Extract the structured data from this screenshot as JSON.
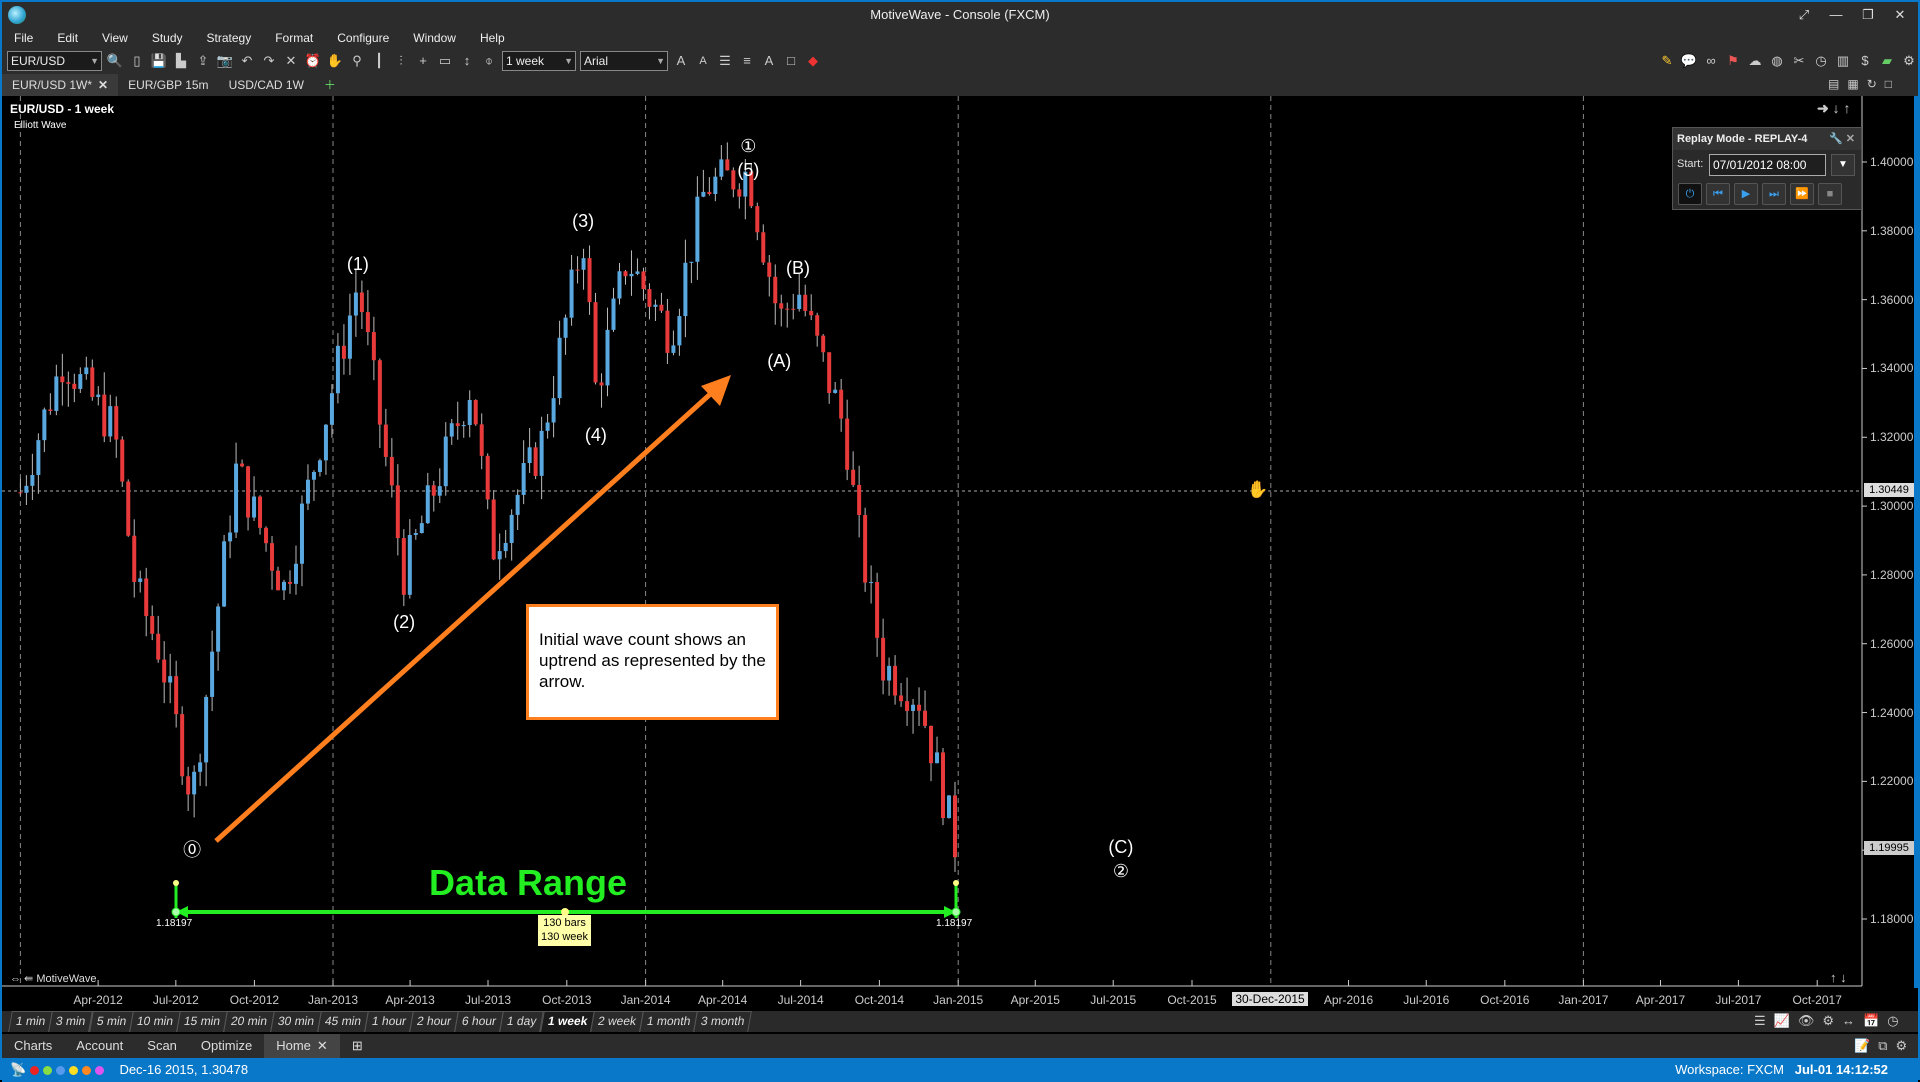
{
  "window": {
    "title": "MotiveWave - Console (FXCM)"
  },
  "menu": [
    "File",
    "Edit",
    "View",
    "Study",
    "Strategy",
    "Format",
    "Configure",
    "Window",
    "Help"
  ],
  "toolbar": {
    "symbol": "EUR/USD",
    "period": "1 week",
    "font": "Arial",
    "icons": [
      "search-icon",
      "new-icon",
      "save-icon",
      "save-as-icon",
      "export-icon",
      "camera-icon",
      "undo-icon",
      "redo-icon",
      "tools-icon",
      "alarm-icon",
      "hand-icon",
      "zoom-icon",
      "candle-icon",
      "bar-type-icon",
      "crosshair-icon",
      "measure-icon",
      "fit-icon",
      "link-icon"
    ]
  },
  "tabs": [
    {
      "label": "EUR/USD 1W*",
      "active": true
    },
    {
      "label": "EUR/GBP 15m"
    },
    {
      "label": "USD/CAD 1W"
    }
  ],
  "chart": {
    "title": "EUR/USD - 1 week",
    "study": "Elliott Wave",
    "watermark": "MotiveWave",
    "crosshair_price": "1.30449",
    "crosshair_date": "30-Dec-2015",
    "last_price": "1.19995",
    "annotation": "Initial wave count shows an uptrend as represented by the arrow.",
    "data_range": {
      "label": "Data Range",
      "start_price": "1.18197",
      "end_price": "1.18197",
      "bars": "130 bars",
      "span": "130 week"
    },
    "wave_labels": [
      {
        "text": "①",
        "date": "2014-05-01",
        "price": 1.4045
      },
      {
        "text": "(5)",
        "date": "2014-05-01",
        "price": 1.3975
      },
      {
        "text": "(3)",
        "date": "2013-10-20",
        "price": 1.3825
      },
      {
        "text": "(1)",
        "date": "2013-01-30",
        "price": 1.37
      },
      {
        "text": "(4)",
        "date": "2013-11-04",
        "price": 1.3205
      },
      {
        "text": "(2)",
        "date": "2013-03-25",
        "price": 1.266
      },
      {
        "text": "(B)",
        "date": "2014-06-28",
        "price": 1.369
      },
      {
        "text": "(A)",
        "date": "2014-06-06",
        "price": 1.342
      },
      {
        "text": "⓪",
        "date": "2012-07-20",
        "price": 1.201
      },
      {
        "text": "(C)",
        "date": "2015-07-10",
        "price": 1.2005
      },
      {
        "text": "②",
        "date": "2015-07-10",
        "price": 1.1938
      }
    ]
  },
  "chart_data": {
    "type": "candlestick",
    "symbol": "EUR/USD",
    "interval": "1 week",
    "ylim": [
      1.17,
      1.41
    ],
    "y_ticks": [
      "1.40000",
      "1.38000",
      "1.36000",
      "1.34000",
      "1.32000",
      "1.30000",
      "1.28000",
      "1.26000",
      "1.24000",
      "1.22000",
      "1.20000",
      "1.18000"
    ],
    "x_ticks": [
      {
        "label": "Apr-2012",
        "date": "2012-04-01"
      },
      {
        "label": "Jul-2012",
        "date": "2012-07-01"
      },
      {
        "label": "Oct-2012",
        "date": "2012-10-01"
      },
      {
        "label": "Jan-2013",
        "date": "2013-01-01"
      },
      {
        "label": "Apr-2013",
        "date": "2013-04-01"
      },
      {
        "label": "Jul-2013",
        "date": "2013-07-01"
      },
      {
        "label": "Oct-2013",
        "date": "2013-10-01"
      },
      {
        "label": "Jan-2014",
        "date": "2014-01-01"
      },
      {
        "label": "Apr-2014",
        "date": "2014-04-01"
      },
      {
        "label": "Jul-2014",
        "date": "2014-07-01"
      },
      {
        "label": "Oct-2014",
        "date": "2014-10-01"
      },
      {
        "label": "Jan-2015",
        "date": "2015-01-01"
      },
      {
        "label": "Apr-2015",
        "date": "2015-04-01"
      },
      {
        "label": "Jul-2015",
        "date": "2015-07-01"
      },
      {
        "label": "Oct-2015",
        "date": "2015-10-01"
      },
      {
        "label": "Apr-2016",
        "date": "2016-04-01"
      },
      {
        "label": "Jul-2016",
        "date": "2016-07-01"
      },
      {
        "label": "Oct-2016",
        "date": "2016-10-01"
      },
      {
        "label": "Jan-2017",
        "date": "2017-01-01"
      },
      {
        "label": "Apr-2017",
        "date": "2017-04-01"
      },
      {
        "label": "Jul-2017",
        "date": "2017-07-01"
      },
      {
        "label": "Oct-2017",
        "date": "2017-10-01"
      }
    ],
    "swing_closes": [
      [
        "2012-01-01",
        1.304
      ],
      [
        "2012-02-20",
        1.343
      ],
      [
        "2012-04-20",
        1.322
      ],
      [
        "2012-05-15",
        1.276
      ],
      [
        "2012-06-12",
        1.258
      ],
      [
        "2012-07-20",
        1.215
      ],
      [
        "2012-09-10",
        1.311
      ],
      [
        "2012-11-05",
        1.276
      ],
      [
        "2013-01-30",
        1.365
      ],
      [
        "2013-03-25",
        1.28
      ],
      [
        "2013-06-12",
        1.336
      ],
      [
        "2013-07-05",
        1.287
      ],
      [
        "2013-09-01",
        1.318
      ],
      [
        "2013-10-20",
        1.379
      ],
      [
        "2013-11-04",
        1.333
      ],
      [
        "2013-12-10",
        1.372
      ],
      [
        "2014-01-30",
        1.35
      ],
      [
        "2014-03-12",
        1.393
      ],
      [
        "2014-05-01",
        1.397
      ],
      [
        "2014-06-06",
        1.354
      ],
      [
        "2014-06-28",
        1.363
      ],
      [
        "2014-08-22",
        1.322
      ],
      [
        "2014-09-05",
        1.294
      ],
      [
        "2014-10-05",
        1.254
      ],
      [
        "2014-11-17",
        1.244
      ],
      [
        "2014-12-29",
        1.201
      ]
    ],
    "colors": {
      "up": "#5aa8e0",
      "down": "#e83a3a",
      "arrow": "#ff7f1e",
      "range": "#22ee22"
    }
  },
  "replay": {
    "title": "Replay Mode - REPLAY-4",
    "start_label": "Start:",
    "start_value": "07/01/2012 08:00"
  },
  "timeframes": [
    {
      "label": "1 min"
    },
    {
      "label": "3 min"
    },
    {
      "label": "5 min"
    },
    {
      "label": "10 min"
    },
    {
      "label": "15 min"
    },
    {
      "label": "20 min"
    },
    {
      "label": "30 min"
    },
    {
      "label": "45 min"
    },
    {
      "label": "1 hour"
    },
    {
      "label": "2 hour"
    },
    {
      "label": "6 hour"
    },
    {
      "label": "1 day"
    },
    {
      "label": "1 week",
      "active": true
    },
    {
      "label": "2 week"
    },
    {
      "label": "1 month"
    },
    {
      "label": "3 month"
    }
  ],
  "bottom_tabs": [
    {
      "label": "Charts"
    },
    {
      "label": "Account"
    },
    {
      "label": "Scan"
    },
    {
      "label": "Optimize"
    },
    {
      "label": "Home",
      "active": true
    }
  ],
  "status": {
    "cursor": "Dec-16 2015, 1.30478",
    "workspace": "Workspace: FXCM",
    "clock": "Jul-01 14:12:52"
  }
}
